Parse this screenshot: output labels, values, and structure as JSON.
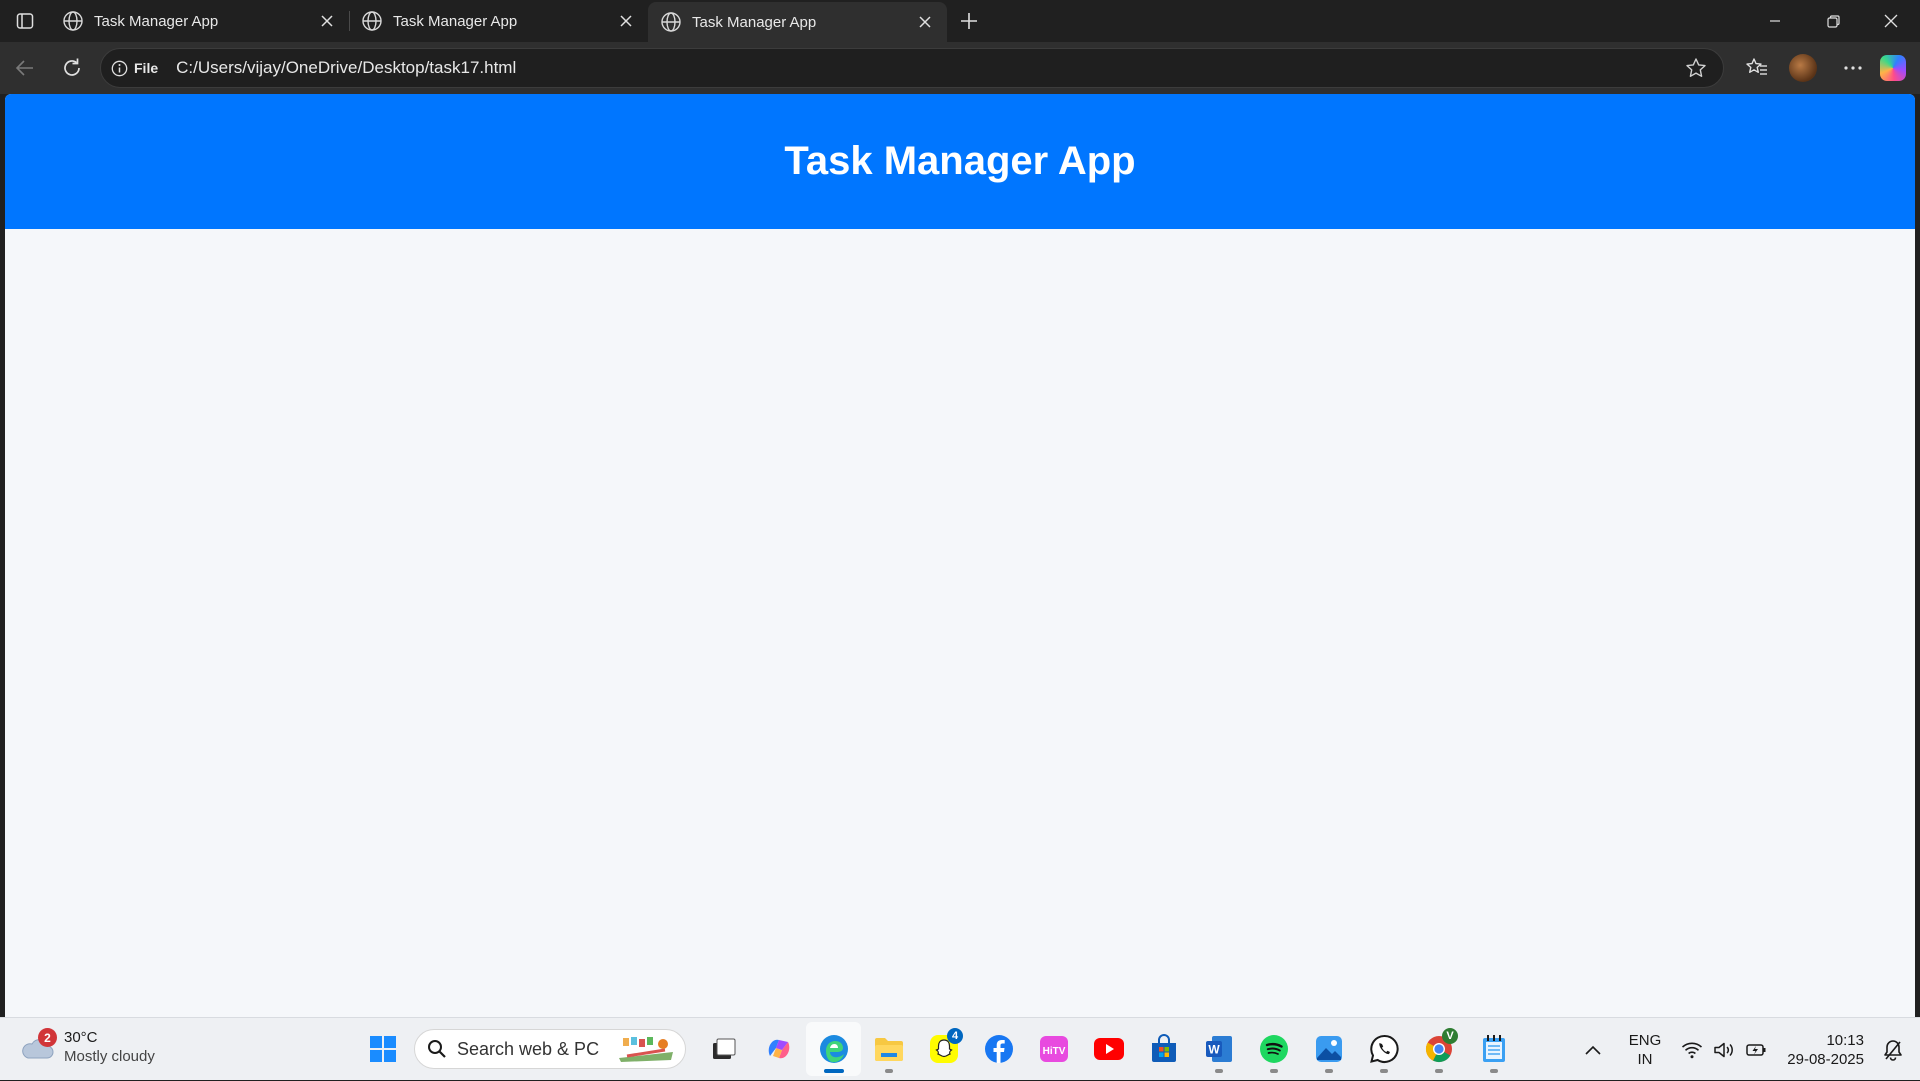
{
  "browser": {
    "tabs": [
      {
        "title": "Task Manager App"
      },
      {
        "title": "Task Manager App"
      },
      {
        "title": "Task Manager App"
      }
    ],
    "address": {
      "scheme_label": "File",
      "url": "C:/Users/vijay/OneDrive/Desktop/task17.html"
    }
  },
  "page": {
    "header_title": "Task Manager App",
    "header_color": "#0076ff",
    "background_color": "#f5f7fa"
  },
  "taskbar": {
    "weather": {
      "temp": "30°C",
      "condition": "Mostly cloudy",
      "badge": "2"
    },
    "search_placeholder": "Search web & PC",
    "snapchat_badge": "4",
    "chrome_badge": "V",
    "tray": {
      "lang_top": "ENG",
      "lang_bottom": "IN",
      "time": "10:13",
      "date": "29-08-2025"
    }
  }
}
